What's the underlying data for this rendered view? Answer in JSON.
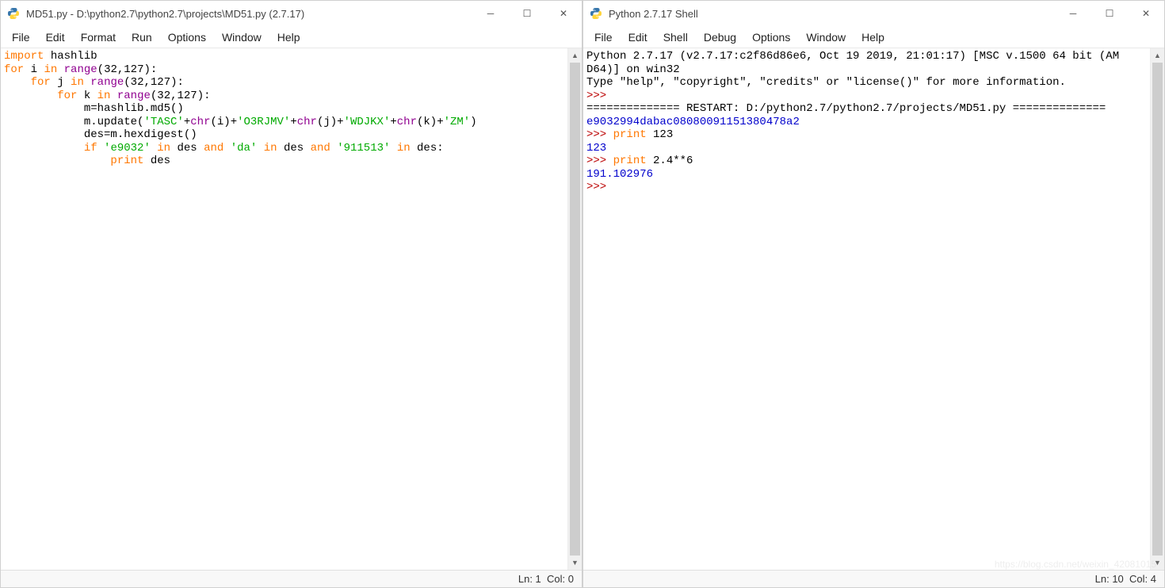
{
  "editor": {
    "title": "MD51.py - D:\\python2.7\\python2.7\\projects\\MD51.py (2.7.17)",
    "menus": {
      "file": "File",
      "edit": "Edit",
      "format": "Format",
      "run": "Run",
      "options": "Options",
      "window": "Window",
      "help": "Help"
    },
    "status": {
      "ln": "Ln: 1",
      "col": "Col: 0"
    },
    "code": {
      "l1_import": "import",
      "l1_rest": " hashlib",
      "l2_for": "for",
      "l2_a": " i ",
      "l2_in": "in",
      "l2_b": " ",
      "l2_range": "range",
      "l2_args": "(32,127):",
      "l3_pre": "    ",
      "l3_for": "for",
      "l3_a": " j ",
      "l3_in": "in",
      "l3_b": " ",
      "l3_range": "range",
      "l3_args": "(32,127):",
      "l4_pre": "        ",
      "l4_for": "for",
      "l4_a": " k ",
      "l4_in": "in",
      "l4_b": " ",
      "l4_range": "range",
      "l4_args": "(32,127):",
      "l5": "            m=hashlib.md5()",
      "l6_pre": "            m.update(",
      "l6_s1": "'TASC'",
      "l6_a": "+",
      "l6_chr1": "chr",
      "l6_b": "(i)+",
      "l6_s2": "'O3RJMV'",
      "l6_c": "+",
      "l6_chr2": "chr",
      "l6_d": "(j)+",
      "l6_s3": "'WDJKX'",
      "l6_e": "+",
      "l6_chr3": "chr",
      "l6_f": "(k)+",
      "l6_s4": "'ZM'",
      "l6_g": ")",
      "l7": "            des=m.hexdigest()",
      "l8_pre": "            ",
      "l8_if": "if",
      "l8_a": " ",
      "l8_s1": "'e9032'",
      "l8_b": " ",
      "l8_in1": "in",
      "l8_c": " des ",
      "l8_and1": "and",
      "l8_d": " ",
      "l8_s2": "'da'",
      "l8_e": " ",
      "l8_in2": "in",
      "l8_f": " des ",
      "l8_and2": "and",
      "l8_g": " ",
      "l8_s3": "'911513'",
      "l8_h": " ",
      "l8_in3": "in",
      "l8_i": " des:",
      "l9_pre": "                ",
      "l9_print": "print",
      "l9_rest": " des"
    }
  },
  "shell": {
    "title": "Python 2.7.17 Shell",
    "menus": {
      "file": "File",
      "edit": "Edit",
      "shell": "Shell",
      "debug": "Debug",
      "options": "Options",
      "window": "Window",
      "help": "Help"
    },
    "status": {
      "ln": "Ln: 10",
      "col": "Col: 4"
    },
    "out": {
      "l1a": "Python 2.7.17 (v2.7.17:c2f86d86e6, Oct 19 2019, 21:01:17) [MSC v.1500 64 bit (AM",
      "l1b": "D64)] on win32",
      "l2": "Type \"help\", \"copyright\", \"credits\" or \"license()\" for more information.",
      "p": ">>> ",
      "restart": "============== RESTART: D:/python2.7/python2.7/projects/MD51.py ==============",
      "hash": "e9032994dabac08080091151380478a2",
      "print1_kw": "print",
      "print1_rest": " 123",
      "out1": "123",
      "print2_kw": "print",
      "print2_rest": " 2.4**6",
      "out2": "191.102976"
    }
  },
  "watermark": "https://blog.csdn.net/weixin_42081015"
}
